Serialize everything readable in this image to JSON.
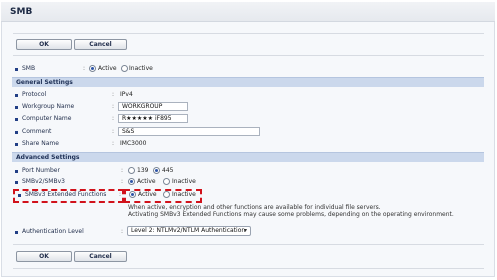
{
  "header": {
    "title": "SMB"
  },
  "top_buttons": {
    "ok": "OK",
    "cancel": "Cancel"
  },
  "smb": {
    "label": "SMB",
    "active": "Active",
    "inactive": "Inactive",
    "selected": "Active"
  },
  "general": {
    "heading": "General Settings",
    "protocol": {
      "label": "Protocol",
      "value": "IPv4"
    },
    "workgroup": {
      "label": "Workgroup Name",
      "value": "WORKGROUP"
    },
    "computer": {
      "label": "Computer Name",
      "value": "R★★★★★  iF895"
    },
    "comment": {
      "label": "Comment",
      "value": "S&S"
    },
    "share": {
      "label": "Share Name",
      "value": "IMC3000"
    }
  },
  "advanced": {
    "heading": "Advanced Settings",
    "port": {
      "label": "Port Number",
      "opt1": "139",
      "opt2": "445",
      "selected": "445"
    },
    "smbv2": {
      "label": "SMBv2/SMBv3",
      "active": "Active",
      "inactive": "Inactive",
      "selected": "Active"
    },
    "smbv3ext": {
      "label": "SMBv3 Extended Functions",
      "active": "Active",
      "inactive": "Inactive",
      "selected": "Active",
      "desc1": "When active, encryption and other functions are available for individual file servers.",
      "desc2": "Activating SMBv3 Extended Functions may cause some problems, depending on the operating environment."
    },
    "auth": {
      "label": "Authentication Level",
      "value": "Level 2: NTLMv2/NTLM Authentication"
    }
  },
  "bottom_buttons": {
    "ok": "OK",
    "cancel": "Cancel"
  },
  "colors": {
    "highlight": "#d1121b",
    "section_bg": "#cbd8ec",
    "accent": "#223f86"
  }
}
